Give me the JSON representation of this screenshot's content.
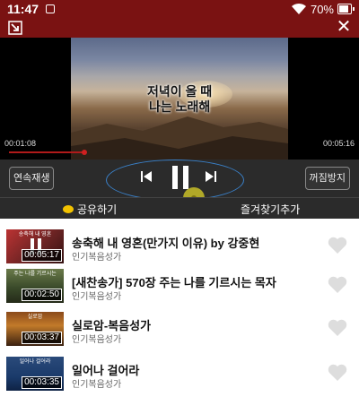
{
  "status": {
    "time": "11:47",
    "battery": "70%",
    "battery_level": 0.7
  },
  "header": {
    "shrink_icon": "shrink-arrow-icon",
    "close_icon": "close-icon",
    "close_glyph": "✕"
  },
  "player": {
    "lyrics": [
      "저녁이 올 때",
      "나는 노래해"
    ],
    "elapsed": "00:01:08",
    "total": "00:05:16",
    "progress": 0.215
  },
  "controls": {
    "repeat_label": "연속재생",
    "sleep_label": "꺼짐방지"
  },
  "actions": {
    "share_label": "공유하기",
    "favorite_label": "즐겨찾기추가"
  },
  "playlist": [
    {
      "title": "송축해 내 영혼(만가지 이유) by 강중현",
      "subtitle": "인기복음성가",
      "duration": "00:05:17",
      "playing": true
    },
    {
      "title": "[새찬송가] 570장 주는 나를 기르시는 목자",
      "subtitle": "인기복음성가",
      "duration": "00:02:50",
      "playing": false
    },
    {
      "title": "실로암-복음성가",
      "subtitle": "인기복음성가",
      "duration": "00:03:37",
      "playing": false
    },
    {
      "title": "일어나 걸어라",
      "subtitle": "인기복음성가",
      "duration": "00:03:35",
      "playing": false
    }
  ],
  "colors": {
    "header": "#7a1212",
    "controls": "#2b2b2b",
    "accent": "#b01a1a",
    "ring": "#3a80c8"
  }
}
